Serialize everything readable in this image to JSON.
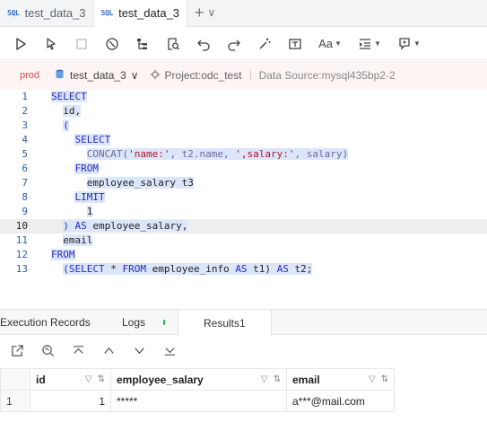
{
  "tabs": [
    {
      "badge": "SQL",
      "label": "test_data_3",
      "active": false
    },
    {
      "badge": "SQL",
      "label": "test_data_3",
      "active": true
    }
  ],
  "tab_actions": {
    "add": "+",
    "more": "∨"
  },
  "toolbar": {
    "icons": [
      "run-icon",
      "run-selection-icon",
      "stop-icon",
      "plan-icon",
      "tree-icon",
      "search-doc-icon",
      "undo-icon",
      "redo-icon",
      "wand-icon",
      "format-icon",
      "font-size-icon",
      "indent-icon",
      "snippet-icon"
    ],
    "font_label": "Aa"
  },
  "context": {
    "env": "prod",
    "database": "test_data_3",
    "project": "Project:odc_test",
    "datasource": "Data Source:mysql435bp2-2"
  },
  "editor": {
    "current_line": 10,
    "lines": [
      {
        "n": "1",
        "indent": 0,
        "tokens": [
          {
            "t": "kw",
            "v": "SELECT"
          }
        ]
      },
      {
        "n": "2",
        "indent": 2,
        "tokens": [
          {
            "t": "id",
            "v": "id,"
          }
        ]
      },
      {
        "n": "3",
        "indent": 2,
        "tokens": [
          {
            "t": "kw",
            "v": "("
          }
        ]
      },
      {
        "n": "4",
        "indent": 4,
        "tokens": [
          {
            "t": "kw",
            "v": "SELECT"
          }
        ]
      },
      {
        "n": "5",
        "indent": 6,
        "tokens": [
          {
            "t": "fn",
            "v": "CONCAT("
          },
          {
            "t": "str",
            "v": "'name:'"
          },
          {
            "t": "fn",
            "v": ", t2.name, "
          },
          {
            "t": "str",
            "v": "',salary:'"
          },
          {
            "t": "fn",
            "v": ", salary)"
          }
        ]
      },
      {
        "n": "6",
        "indent": 4,
        "tokens": [
          {
            "t": "kw",
            "v": "FROM"
          }
        ]
      },
      {
        "n": "7",
        "indent": 6,
        "tokens": [
          {
            "t": "id",
            "v": "employee_salary t3"
          }
        ]
      },
      {
        "n": "8",
        "indent": 4,
        "tokens": [
          {
            "t": "kw",
            "v": "LIMIT"
          }
        ]
      },
      {
        "n": "9",
        "indent": 6,
        "tokens": [
          {
            "t": "id",
            "v": "1"
          }
        ]
      },
      {
        "n": "10",
        "indent": 2,
        "tokens": [
          {
            "t": "kw",
            "v": ")"
          },
          {
            "t": "id",
            "v": " "
          },
          {
            "t": "kw",
            "v": "AS"
          },
          {
            "t": "id",
            "v": " employee_salary,"
          }
        ]
      },
      {
        "n": "11",
        "indent": 2,
        "tokens": [
          {
            "t": "id",
            "v": "email"
          }
        ]
      },
      {
        "n": "12",
        "indent": 0,
        "tokens": [
          {
            "t": "kw",
            "v": "FROM"
          }
        ]
      },
      {
        "n": "13",
        "indent": 2,
        "tokens": [
          {
            "t": "kw",
            "v": "(SELECT"
          },
          {
            "t": "id",
            "v": " * "
          },
          {
            "t": "kw",
            "v": "FROM"
          },
          {
            "t": "id",
            "v": " employee_info "
          },
          {
            "t": "kw",
            "v": "AS"
          },
          {
            "t": "id",
            "v": " t1) "
          },
          {
            "t": "kw",
            "v": "AS"
          },
          {
            "t": "id",
            "v": " t2;"
          }
        ]
      }
    ]
  },
  "bottom_tabs": {
    "execution_records": "Execution Records",
    "logs": "Logs",
    "results": "Results1"
  },
  "results": {
    "columns": [
      {
        "key": "id",
        "label": "id"
      },
      {
        "key": "employee_salary",
        "label": "employee_salary"
      },
      {
        "key": "email",
        "label": "email"
      }
    ],
    "rows": [
      {
        "num": "1",
        "id": "1",
        "employee_salary": "*****",
        "email": "a***@mail.com"
      }
    ]
  }
}
